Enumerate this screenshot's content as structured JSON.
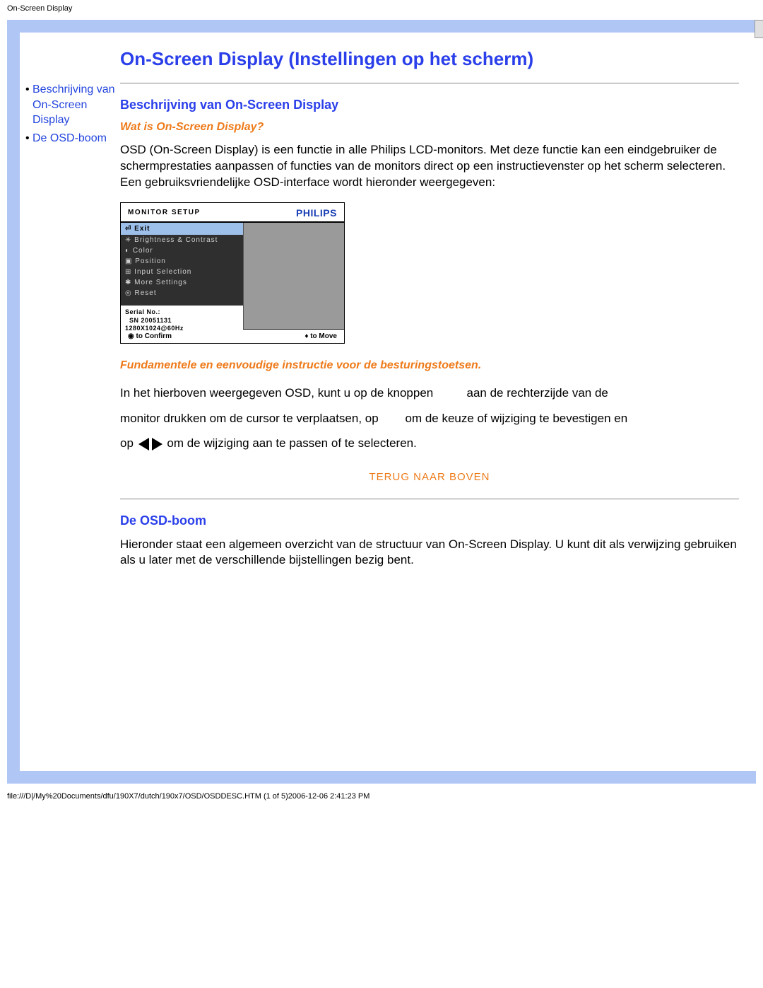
{
  "pageHeader": "On-Screen Display",
  "sidebar": {
    "items": [
      {
        "label": "Beschrijving van On-Screen Display"
      },
      {
        "label": "De OSD-boom"
      }
    ]
  },
  "title": "On-Screen Display (Instellingen op het scherm)",
  "section1": {
    "heading": "Beschrijving van On-Screen Display",
    "subQuestion": "Wat is On-Screen Display?",
    "paragraph": "OSD (On-Screen Display) is een functie in alle Philips LCD-monitors. Met deze functie kan een eindgebruiker de schermprestaties aanpassen of functies van de monitors direct op een instructievenster op het scherm selecteren. Een gebruiksvriendelijke OSD-interface wordt hieronder weergegeven:"
  },
  "osd": {
    "title": "MONITOR SETUP",
    "brand": "PHILIPS",
    "selected": "Exit",
    "menu": [
      "Brightness & Contrast",
      "Color",
      "Position",
      "Input Selection",
      "More Settings",
      "Reset"
    ],
    "serialLabel": "Serial No.:",
    "serialValue": "SN 20051131",
    "resolution": "1280X1024@60Hz",
    "confirm": "◉ to Confirm",
    "move": "♦ to Move"
  },
  "instrHeading": "Fundamentele en eenvoudige instructie voor de besturingstoetsen.",
  "flow": {
    "p1a": "In het hierboven weergegeven OSD, kunt u op de knoppen",
    "p1b": "aan de rechterzijde van de",
    "p2a": "monitor drukken om de cursor te verplaatsen, op",
    "p2b": "om de keuze of wijziging te bevestigen en",
    "p3a": "op",
    "p3b": "om de wijziging aan te passen of te selecteren."
  },
  "topLink": "TERUG NAAR BOVEN",
  "section2": {
    "heading": "De OSD-boom",
    "paragraph": "Hieronder staat een algemeen overzicht van de structuur van On-Screen Display. U kunt dit als verwijzing gebruiken als u later met de verschillende bijstellingen bezig bent."
  },
  "footer": "file:///D|/My%20Documents/dfu/190X7/dutch/190x7/OSD/OSDDESC.HTM (1 of 5)2006-12-06 2:41:23 PM"
}
